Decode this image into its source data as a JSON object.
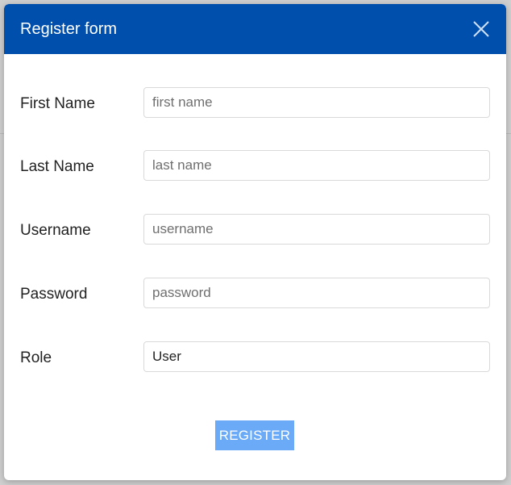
{
  "modal": {
    "title": "Register form",
    "close_icon": "close-icon",
    "header_color": "#004fad"
  },
  "form": {
    "fields": [
      {
        "label": "First Name",
        "placeholder": "first name",
        "value": ""
      },
      {
        "label": "Last Name",
        "placeholder": "last name",
        "value": ""
      },
      {
        "label": "Username",
        "placeholder": "username",
        "value": ""
      },
      {
        "label": "Password",
        "placeholder": "password",
        "value": ""
      },
      {
        "label": "Role",
        "placeholder": "",
        "value": "User"
      }
    ],
    "submit_label": "REGISTER",
    "submit_color": "#6aaaf7"
  }
}
